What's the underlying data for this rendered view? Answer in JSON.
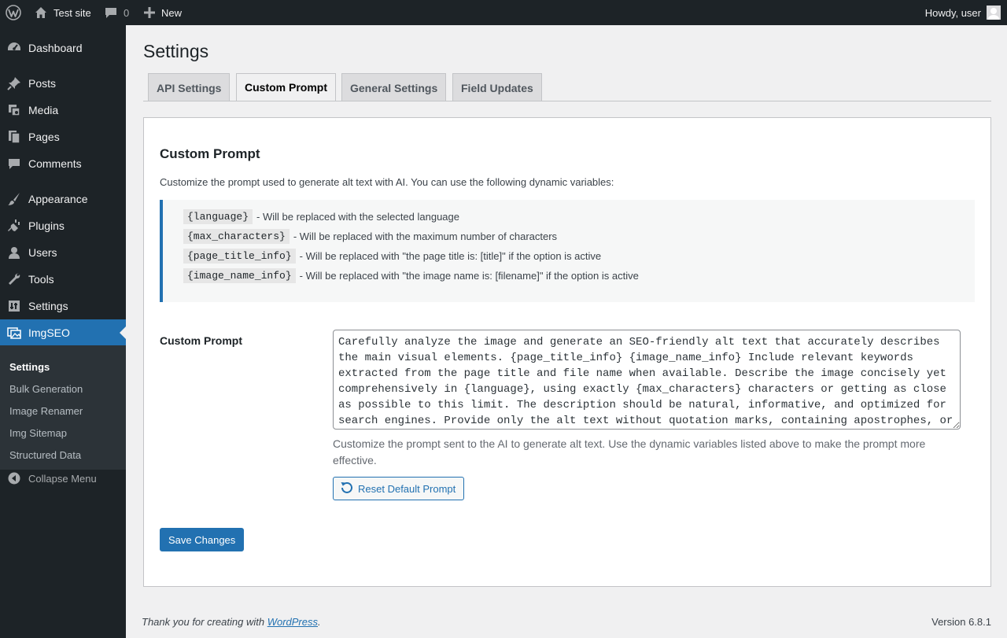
{
  "adminbar": {
    "site_name": "Test site",
    "comments_count": "0",
    "new_label": "New",
    "howdy": "Howdy, user"
  },
  "sidebar": {
    "items": [
      {
        "label": "Dashboard",
        "icon": "dashboard-icon"
      },
      {
        "label": "Posts",
        "icon": "pin-icon"
      },
      {
        "label": "Media",
        "icon": "media-icon"
      },
      {
        "label": "Pages",
        "icon": "pages-icon"
      },
      {
        "label": "Comments",
        "icon": "comment-icon"
      },
      {
        "label": "Appearance",
        "icon": "brush-icon"
      },
      {
        "label": "Plugins",
        "icon": "plug-icon"
      },
      {
        "label": "Users",
        "icon": "user-icon"
      },
      {
        "label": "Tools",
        "icon": "wrench-icon"
      },
      {
        "label": "Settings",
        "icon": "settings-icon"
      },
      {
        "label": "ImgSEO",
        "icon": "images-icon"
      }
    ],
    "submenu": [
      "Settings",
      "Bulk Generation",
      "Image Renamer",
      "Img Sitemap",
      "Structured Data"
    ],
    "collapse_label": "Collapse Menu"
  },
  "page": {
    "title": "Settings",
    "tabs": [
      "API Settings",
      "Custom Prompt",
      "General Settings",
      "Field Updates"
    ],
    "active_tab": "Custom Prompt"
  },
  "card": {
    "heading": "Custom Prompt",
    "intro": "Customize the prompt used to generate alt text with AI. You can use the following dynamic variables:",
    "variables": [
      {
        "code": "{language}",
        "desc": "- Will be replaced with the selected language"
      },
      {
        "code": "{max_characters}",
        "desc": "- Will be replaced with the maximum number of characters"
      },
      {
        "code": "{page_title_info}",
        "desc": "- Will be replaced with \"the page title is: [title]\" if the option is active"
      },
      {
        "code": "{image_name_info}",
        "desc": "- Will be replaced with \"the image name is: [filename]\" if the option is active"
      }
    ],
    "field_label": "Custom Prompt",
    "prompt_value": "Carefully analyze the image and generate an SEO-friendly alt text that accurately describes the main visual elements. {page_title_info} {image_name_info} Include relevant keywords extracted from the page title and file name when available. Describe the image concisely yet comprehensively in {language}, using exactly {max_characters} characters or getting as close as possible to this limit. The description should be natural, informative, and optimized for search engines. Provide only the alt text without quotation marks, containing apostrophes, or",
    "description": "Customize the prompt sent to the AI to generate alt text. Use the dynamic variables listed above to make the prompt more effective.",
    "reset_label": "Reset Default Prompt",
    "save_label": "Save Changes"
  },
  "footer": {
    "thanks_prefix": "Thank you for creating with ",
    "thanks_link": "WordPress",
    "thanks_suffix": ".",
    "version": "Version 6.8.1"
  },
  "colors": {
    "accent": "#2271b1",
    "adminbar_bg": "#1d2327",
    "submenu_bg": "#2c3338"
  }
}
